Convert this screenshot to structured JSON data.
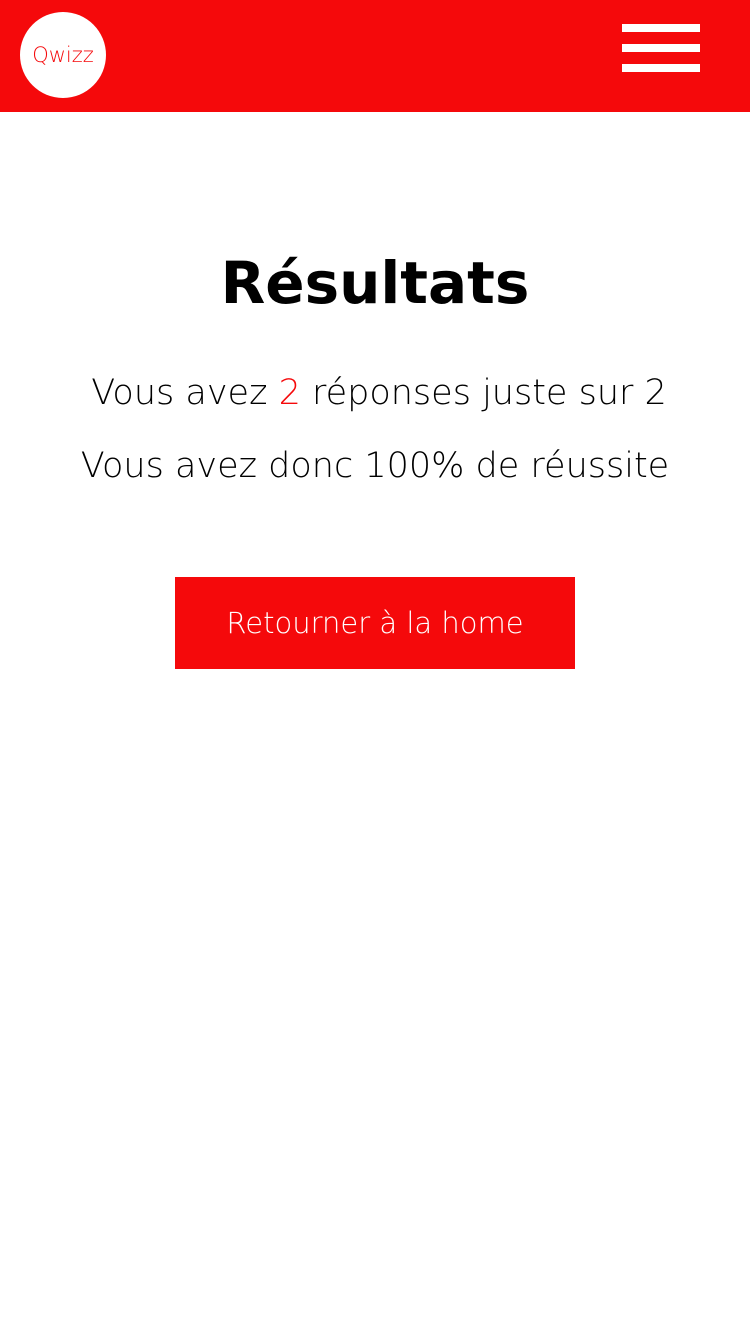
{
  "colors": {
    "brand_red": "#F5090B",
    "white": "#FFFFFF",
    "text": "#000000"
  },
  "header": {
    "logo_text": "Qwizz",
    "menu_icon": "hamburger-menu-icon"
  },
  "results": {
    "title": "Résultats",
    "score_prefix": "Vous avez ",
    "score_correct": "2",
    "score_suffix": " réponses juste sur 2",
    "percentage_text": "Vous avez donc 100% de réussite"
  },
  "actions": {
    "home_button_label": "Retourner à la home"
  }
}
